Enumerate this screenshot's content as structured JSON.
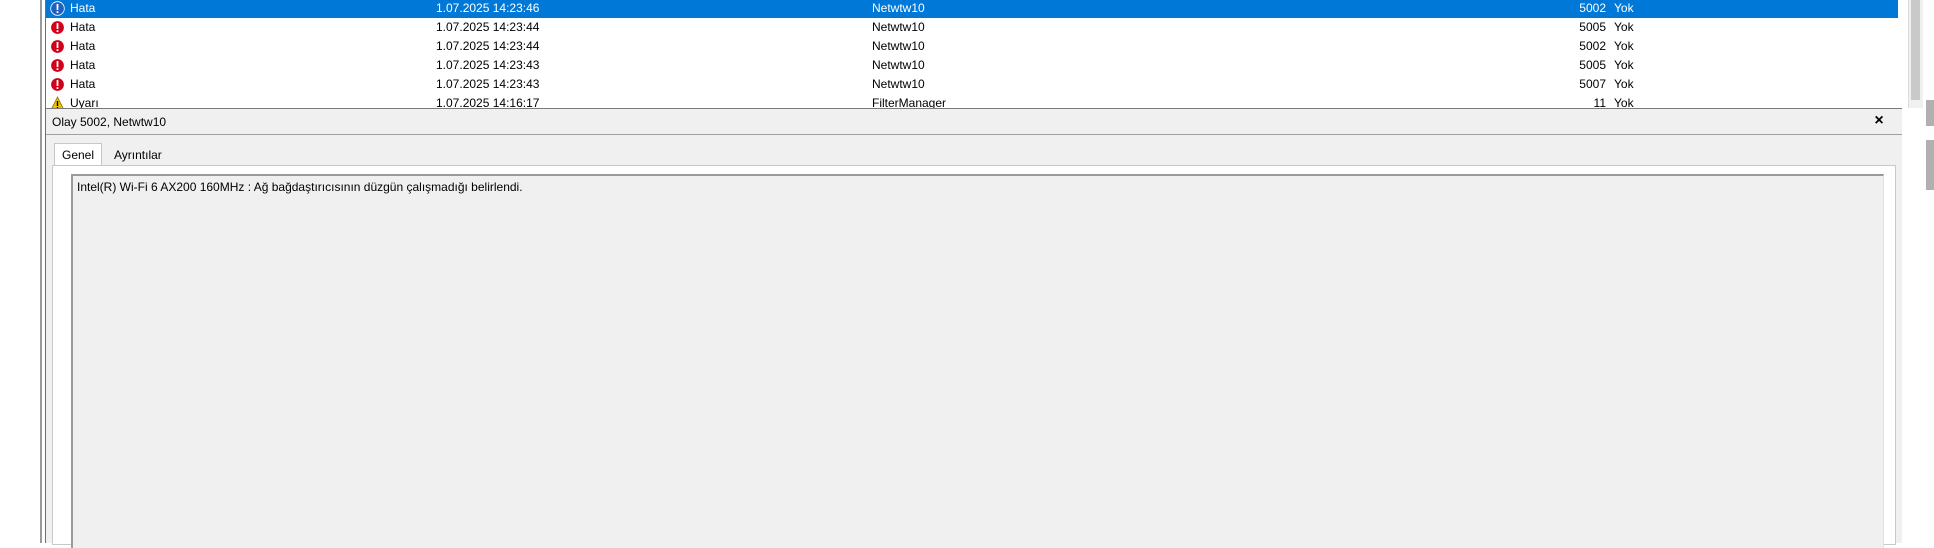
{
  "events": [
    {
      "level": "Hata",
      "icon": "info-icon",
      "date": "1.07.2025 14:23:46",
      "source": "Netwtw10",
      "id": "5002",
      "category": "Yok",
      "selected": true
    },
    {
      "level": "Hata",
      "icon": "error-icon",
      "date": "1.07.2025 14:23:44",
      "source": "Netwtw10",
      "id": "5005",
      "category": "Yok",
      "selected": false
    },
    {
      "level": "Hata",
      "icon": "error-icon",
      "date": "1.07.2025 14:23:44",
      "source": "Netwtw10",
      "id": "5002",
      "category": "Yok",
      "selected": false
    },
    {
      "level": "Hata",
      "icon": "error-icon",
      "date": "1.07.2025 14:23:43",
      "source": "Netwtw10",
      "id": "5005",
      "category": "Yok",
      "selected": false
    },
    {
      "level": "Hata",
      "icon": "error-icon",
      "date": "1.07.2025 14:23:43",
      "source": "Netwtw10",
      "id": "5007",
      "category": "Yok",
      "selected": false
    },
    {
      "level": "Uyarı",
      "icon": "warning-icon",
      "date": "1.07.2025 14:16:17",
      "source": "FilterManager",
      "id": "11",
      "category": "Yok",
      "selected": false
    }
  ],
  "details": {
    "title": "Olay 5002, Netwtw10",
    "close_label": "×",
    "tabs": [
      "Genel",
      "Ayrıntılar"
    ],
    "message": "Intel(R) Wi-Fi 6 AX200 160MHz : Ağ bağdaştırıcısının düzgün çalışmadığı belirlendi."
  },
  "colors": {
    "selection": "#0078d7",
    "error": "#d0021b",
    "warning": "#f2c200"
  }
}
